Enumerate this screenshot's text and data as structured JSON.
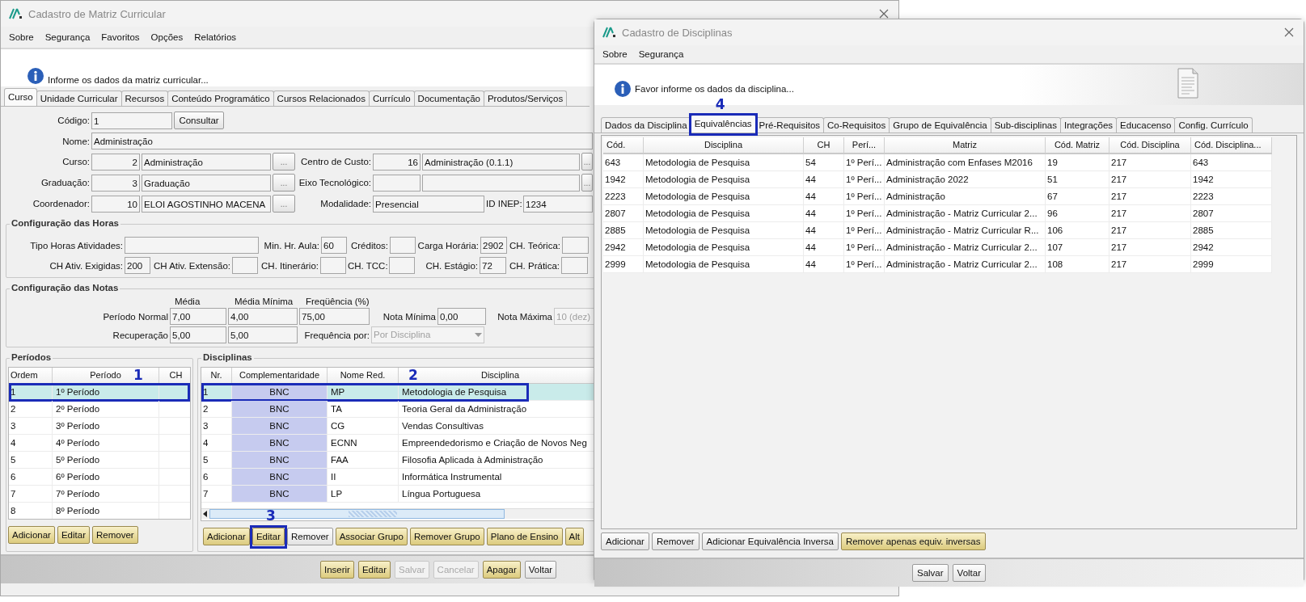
{
  "main_window": {
    "title": "Cadastro de Matriz Curricular",
    "menu": [
      "Sobre",
      "Segurança",
      "Favoritos",
      "Opções",
      "Relatórios"
    ],
    "info": "Informe os dados da matriz curricular...",
    "tabs": [
      {
        "label": "Curso",
        "selected": true
      },
      {
        "label": "Unidade Curricular",
        "selected": false
      },
      {
        "label": "Recursos",
        "selected": false
      },
      {
        "label": "Conteúdo Programático",
        "selected": false
      },
      {
        "label": "Cursos Relacionados",
        "selected": false
      },
      {
        "label": "Currículo",
        "selected": false
      },
      {
        "label": "Documentação",
        "selected": false
      },
      {
        "label": "Produtos/Serviços",
        "selected": false
      }
    ],
    "form_rows": [
      [
        {
          "kind": "label",
          "text": "Código:"
        },
        {
          "kind": "field",
          "value": "1"
        },
        {
          "kind": "button",
          "text": "Consultar"
        }
      ],
      [
        {
          "kind": "label",
          "text": "Nome:"
        },
        {
          "kind": "field",
          "value": "Administração"
        }
      ],
      [
        {
          "kind": "label",
          "text": "Curso:"
        },
        {
          "kind": "number",
          "value": "2"
        },
        {
          "kind": "field",
          "value": "Administração"
        },
        {
          "kind": "lookup",
          "text": "..."
        },
        {
          "kind": "label",
          "text": "Centro de Custo:"
        },
        {
          "kind": "number",
          "value": "16"
        },
        {
          "kind": "field",
          "value": "Administração (0.1.1)"
        },
        {
          "kind": "lookup",
          "text": "..."
        }
      ],
      [
        {
          "kind": "label",
          "text": "Graduação:"
        },
        {
          "kind": "number",
          "value": "3"
        },
        {
          "kind": "field",
          "value": "Graduação"
        },
        {
          "kind": "lookup",
          "text": "..."
        },
        {
          "kind": "label",
          "text": "Eixo Tecnológico:"
        },
        {
          "kind": "number"
        },
        {
          "kind": "field"
        },
        {
          "kind": "lookup",
          "text": "..."
        }
      ],
      [
        {
          "kind": "label",
          "text": "Coordenador:"
        },
        {
          "kind": "number",
          "value": "10"
        },
        {
          "kind": "field",
          "value": "ELOI AGOSTINHO MACENA"
        },
        {
          "kind": "lookup",
          "text": "..."
        },
        {
          "kind": "label",
          "text": "Modalidade:"
        },
        {
          "kind": "field",
          "value": "Presencial"
        },
        {
          "kind": "label",
          "text": "ID INEP:"
        },
        {
          "kind": "field",
          "value": "1234"
        }
      ]
    ],
    "hours": {
      "title": "Configuração das Horas",
      "lines": [
        {
          "fields": [
            {
              "label": "Tipo Horas Atividades:"
            },
            {
              "label": "Min. Hr. Aula:",
              "value": "60"
            },
            {
              "label": "Créditos:"
            },
            {
              "label": "Carga Horária:",
              "value": "2902"
            },
            {
              "label": "CH. Teórica:"
            }
          ]
        },
        {
          "fields": [
            {
              "label": "CH Ativ. Exigidas:",
              "value": "200"
            },
            {
              "label": "CH Ativ. Extensão:"
            },
            {
              "label": "CH. Itinerário:"
            },
            {
              "label": "CH. TCC:"
            },
            {
              "label": "CH. Estágio:",
              "value": "72"
            },
            {
              "label": "CH. Prática:"
            }
          ]
        }
      ]
    },
    "grades": {
      "title": "Configuração das Notas",
      "headers": [
        "Média",
        "Média Mínima",
        "Freqüência (%)"
      ],
      "rows": [
        [
          {
            "kind": "label",
            "text": "Período Normal"
          },
          {
            "kind": "field",
            "value": "7,00",
            "disabled": false
          },
          {
            "kind": "field",
            "value": "4,00",
            "disabled": false
          },
          {
            "kind": "field",
            "value": "75,00",
            "disabled": false
          },
          {
            "kind": "label",
            "text": "Nota Mínima"
          },
          {
            "kind": "field",
            "value": "0,00",
            "disabled": false
          },
          {
            "kind": "label",
            "text": "Nota Máxima"
          },
          {
            "kind": "field",
            "value": "10 (dez)",
            "disabled": true
          }
        ],
        [
          {
            "kind": "label",
            "text": "Recuperação"
          },
          {
            "kind": "field",
            "value": "5,00",
            "disabled": false
          },
          {
            "kind": "field",
            "value": "5,00",
            "disabled": false
          },
          {
            "kind": "label",
            "text": "Frequência por:"
          },
          {
            "kind": "select",
            "value": "Por Disciplina",
            "disabled": true
          }
        ]
      ]
    },
    "periods": {
      "title": "Períodos",
      "columns": [
        "Ordem",
        "Período",
        "CH"
      ],
      "rows": [
        {
          "cells": [
            "1",
            "1º Período"
          ],
          "selected": true,
          "annotation": "1"
        },
        {
          "cells": [
            "2",
            "2º Período"
          ],
          "selected": false
        },
        {
          "cells": [
            "3",
            "3º Período"
          ],
          "selected": false
        },
        {
          "cells": [
            "4",
            "4º Período"
          ],
          "selected": false
        },
        {
          "cells": [
            "5",
            "5º Período"
          ],
          "selected": false
        },
        {
          "cells": [
            "6",
            "6º Período"
          ],
          "selected": false
        },
        {
          "cells": [
            "7",
            "7º Período"
          ],
          "selected": false
        },
        {
          "cells": [
            "8",
            "8º Período"
          ],
          "selected": false
        }
      ],
      "buttons": [
        {
          "label": "Adicionar",
          "highlighted": true
        },
        {
          "label": "Editar",
          "highlighted": true
        },
        {
          "label": "Remover",
          "highlighted": true
        }
      ]
    },
    "disciplines": {
      "title": "Disciplinas",
      "columns": [
        "Nr.",
        "Complementaridade",
        "Nome Red.",
        "Disciplina"
      ],
      "rows": [
        {
          "cells": [
            "1",
            "BNC",
            "MP",
            "Metodologia de Pesquisa"
          ],
          "selected": true,
          "annotation": "2"
        },
        {
          "cells": [
            "2",
            "BNC",
            "TA",
            "Teoria Geral da Administração"
          ],
          "selected": false
        },
        {
          "cells": [
            "3",
            "BNC",
            "CG",
            "Vendas Consultivas"
          ],
          "selected": false
        },
        {
          "cells": [
            "4",
            "BNC",
            "ECNN",
            "Empreendedorismo e Criação de Novos Neg"
          ],
          "selected": false
        },
        {
          "cells": [
            "5",
            "BNC",
            "FAA",
            "Filosofia Aplicada à Administração"
          ],
          "selected": false
        },
        {
          "cells": [
            "6",
            "BNC",
            "II",
            "Informática Instrumental"
          ],
          "selected": false
        },
        {
          "cells": [
            "7",
            "BNC",
            "LP",
            "Língua Portuguesa"
          ],
          "selected": false
        }
      ],
      "buttons": [
        {
          "label": "Adicionar",
          "highlighted": true
        },
        {
          "label": "Editar",
          "highlighted": true,
          "annotation": "3"
        },
        {
          "label": "Remover",
          "highlighted": false
        },
        {
          "label": "Associar Grupo",
          "highlighted": true
        },
        {
          "label": "Remover Grupo",
          "highlighted": true
        },
        {
          "label": "Plano de Ensino",
          "highlighted": true
        },
        {
          "label": "Alt",
          "highlighted": true
        }
      ]
    },
    "footer_buttons": [
      {
        "label": "Inserir",
        "highlighted": true,
        "disabled": false
      },
      {
        "label": "Editar",
        "highlighted": true,
        "disabled": false
      },
      {
        "label": "Salvar",
        "highlighted": false,
        "disabled": true
      },
      {
        "label": "Cancelar",
        "highlighted": false,
        "disabled": true
      },
      {
        "label": "Apagar",
        "highlighted": true,
        "disabled": false
      },
      {
        "label": "Voltar",
        "highlighted": false,
        "disabled": false
      }
    ]
  },
  "dialog": {
    "title": "Cadastro de Disciplinas",
    "menu": [
      "Sobre",
      "Segurança"
    ],
    "info": "Favor informe os dados da disciplina...",
    "tabs": [
      {
        "label": "Dados da Disciplina",
        "selected": false
      },
      {
        "label": "Equivalências",
        "selected": true,
        "annotation": "4"
      },
      {
        "label": "Pré-Requisitos",
        "selected": false
      },
      {
        "label": "Co-Requisitos",
        "selected": false
      },
      {
        "label": "Grupo de Equivalência",
        "selected": false
      },
      {
        "label": "Sub-disciplinas",
        "selected": false
      },
      {
        "label": "Integrações",
        "selected": false
      },
      {
        "label": "Educacenso",
        "selected": false
      },
      {
        "label": "Config. Currículo",
        "selected": false
      }
    ],
    "table": {
      "columns": [
        "Cód.",
        "Disciplina",
        "CH",
        "Perí...",
        "Matriz",
        "Cód. Matriz",
        "Cód. Disciplina",
        "Cód. Disciplina..."
      ],
      "rows": [
        [
          "643",
          "Metodologia de Pesquisa",
          "54",
          "1º Perí...",
          "Administração com Enfases M2016",
          "19",
          "217",
          "643"
        ],
        [
          "1942",
          "Metodologia de Pesquisa",
          "44",
          "1º Perí...",
          "Administração 2022",
          "51",
          "217",
          "1942"
        ],
        [
          "2223",
          "Metodologia de Pesquisa",
          "44",
          "1º Perí...",
          "Administração",
          "67",
          "217",
          "2223"
        ],
        [
          "2807",
          "Metodologia de Pesquisa",
          "44",
          "1º Perí...",
          "Administração - Matriz Curricular 2...",
          "96",
          "217",
          "2807"
        ],
        [
          "2885",
          "Metodologia de Pesquisa",
          "44",
          "1º Perí...",
          "Administração - Matriz Curricular R...",
          "106",
          "217",
          "2885"
        ],
        [
          "2942",
          "Metodologia de Pesquisa",
          "44",
          "1º Perí...",
          "Administração - Matriz Curricular 2...",
          "107",
          "217",
          "2942"
        ],
        [
          "2999",
          "Metodologia de Pesquisa",
          "44",
          "1º Perí...",
          "Administração - Matriz Curricular 2...",
          "108",
          "217",
          "2999"
        ]
      ]
    },
    "buttons": [
      {
        "label": "Adicionar",
        "highlighted": false
      },
      {
        "label": "Remover",
        "highlighted": false
      },
      {
        "label": "Adicionar Equivalência Inversa",
        "highlighted": false
      },
      {
        "label": "Remover apenas equiv. inversas",
        "highlighted": true
      }
    ],
    "footer_buttons": [
      "Salvar",
      "Voltar"
    ]
  }
}
